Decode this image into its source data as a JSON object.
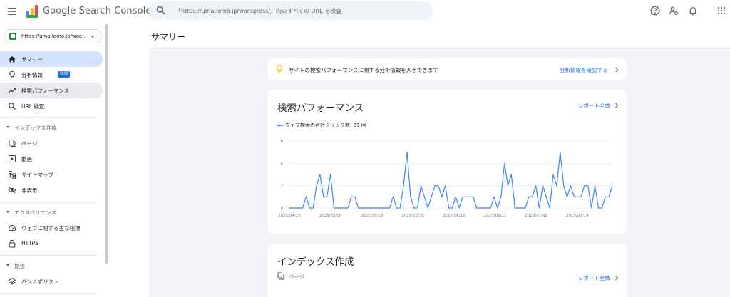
{
  "header": {
    "brand": "Google Search Console",
    "search_placeholder": "「https://uma.lomo.jp/wordpress/」内のすべての URL を検査"
  },
  "property": {
    "label": "https://uma.lomo.jp/wor..."
  },
  "sidebar": {
    "items": [
      {
        "label": "サマリー",
        "icon": "home-icon"
      },
      {
        "label": "分析情報",
        "badge": "新規",
        "icon": "lightbulb-icon"
      },
      {
        "label": "検索パフォーマンス",
        "icon": "trending-up-icon"
      },
      {
        "label": "URL 検査",
        "icon": "search-icon"
      }
    ],
    "sections": [
      {
        "label": "インデックス作成",
        "items": [
          {
            "label": "ページ",
            "icon": "pages-icon"
          },
          {
            "label": "動画",
            "icon": "video-icon"
          },
          {
            "label": "サイトマップ",
            "icon": "sitemap-icon"
          },
          {
            "label": "非表示",
            "icon": "eye-off-icon"
          }
        ]
      },
      {
        "label": "エクスペリエンス",
        "items": [
          {
            "label": "ウェブに関する主な指標",
            "icon": "gauge-icon"
          },
          {
            "label": "HTTPS",
            "icon": "lock-icon"
          }
        ]
      },
      {
        "label": "拡張",
        "items": [
          {
            "label": "パンくずリスト",
            "icon": "layers-icon"
          }
        ]
      }
    ]
  },
  "page": {
    "title": "サマリー"
  },
  "insights_card": {
    "text": "サイトの検索パフォーマンスに関する分析情報を入手できます",
    "link": "分析情報を確認する"
  },
  "performance_card": {
    "title": "検索パフォーマンス",
    "link": "レポート全体",
    "legend": "ウェブ検索の合計クリック数: 87 回"
  },
  "index_card": {
    "title": "インデックス作成",
    "sub": "ページ",
    "link": "レポート全体"
  },
  "colors": {
    "accent": "#1a73e8",
    "line": "#4285f4",
    "active_nav": "#d3e3fd"
  },
  "chart_data": {
    "type": "line",
    "series": [
      {
        "name": "ウェブ検索の合計クリック数",
        "values": [
          0,
          0,
          0,
          0,
          0,
          1,
          0,
          0,
          2,
          3,
          1,
          1,
          3,
          0,
          0,
          0,
          0,
          0,
          1,
          1,
          0,
          0,
          0,
          0,
          0,
          0,
          0,
          0,
          0,
          0,
          1,
          0,
          0,
          2,
          5,
          1,
          0,
          0,
          2,
          1,
          0,
          1,
          2,
          2,
          1,
          2,
          0,
          0,
          1,
          0,
          1,
          1,
          1,
          1,
          0,
          0,
          0,
          0,
          0,
          1,
          0,
          1,
          4,
          2,
          3,
          0,
          0,
          0,
          0,
          1,
          1,
          2,
          0,
          2,
          1,
          0,
          3,
          2,
          5,
          2,
          1,
          2,
          1,
          1,
          1,
          2,
          2,
          0,
          2,
          0,
          0,
          1,
          1,
          2
        ]
      }
    ],
    "x_ticks": [
      "2025/04/26",
      "2025/05/06",
      "2025/05/18",
      "2025/05/30",
      "2025/06/10",
      "2025/06/21",
      "2025/07/02",
      "2025/07/14"
    ],
    "y_ticks": [
      "0",
      "2",
      "4",
      "6"
    ],
    "ylim": [
      0,
      6
    ],
    "grid": true
  }
}
